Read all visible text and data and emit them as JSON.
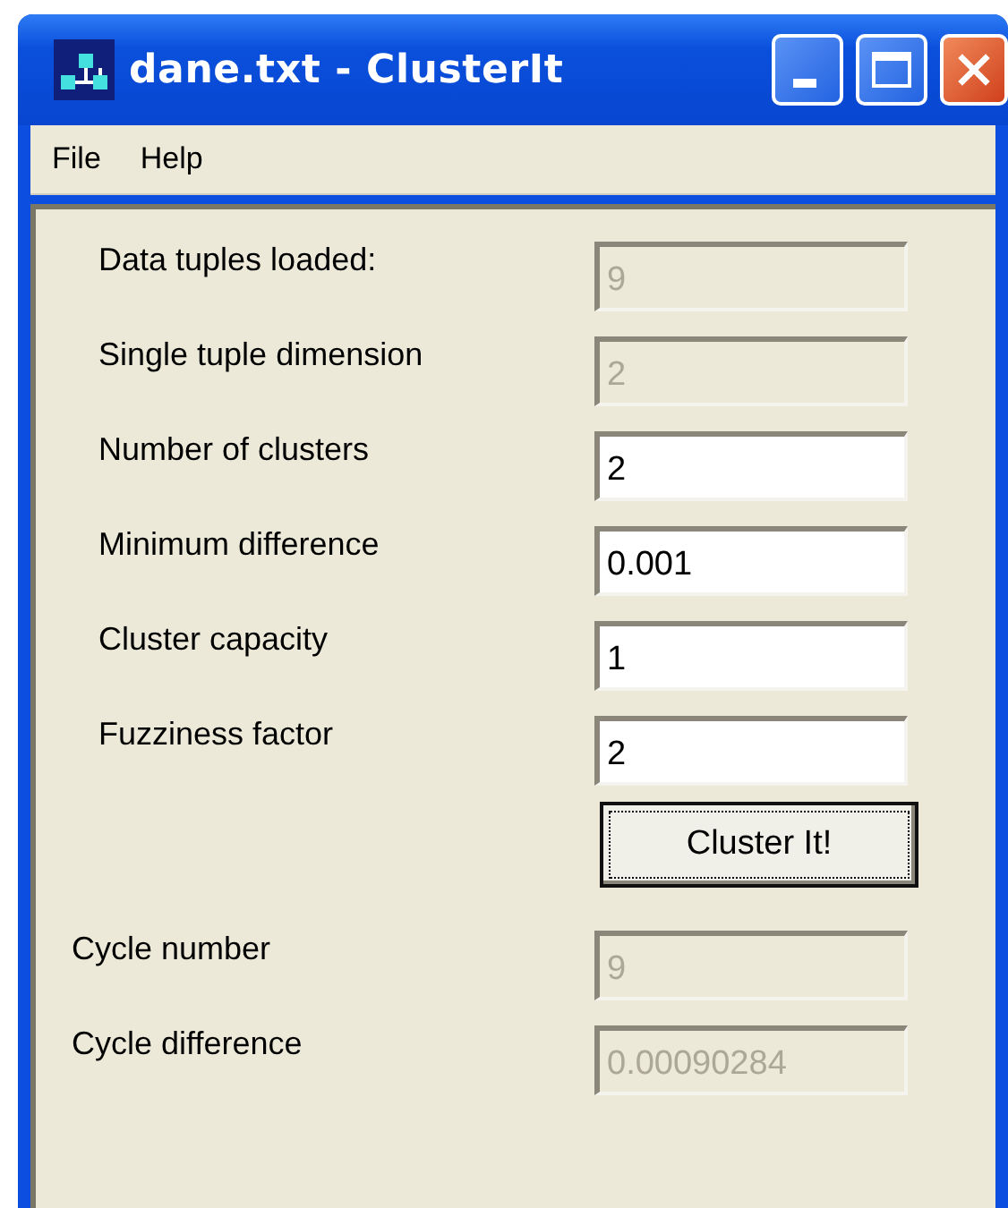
{
  "window": {
    "title": "dane.txt - ClusterIt"
  },
  "menu": [
    "File",
    "Help"
  ],
  "parameters": [
    {
      "label": "Data tuples loaded:",
      "value": "9",
      "disabled": true
    },
    {
      "label": "Single tuple dimension",
      "value": "2",
      "disabled": true
    },
    {
      "label": "Number of clusters",
      "value": "2",
      "disabled": false
    },
    {
      "label": "Minimum difference",
      "value": "0.001",
      "disabled": false
    },
    {
      "label": "Cluster capacity",
      "value": "1",
      "disabled": false
    },
    {
      "label": "Fuzziness factor",
      "value": "2",
      "disabled": false
    }
  ],
  "action_button": {
    "label": "Cluster It!"
  },
  "results": [
    {
      "label": "Cycle number",
      "value": "9",
      "disabled": true
    },
    {
      "label": "Cycle difference",
      "value": "0.00090284",
      "disabled": true
    }
  ]
}
